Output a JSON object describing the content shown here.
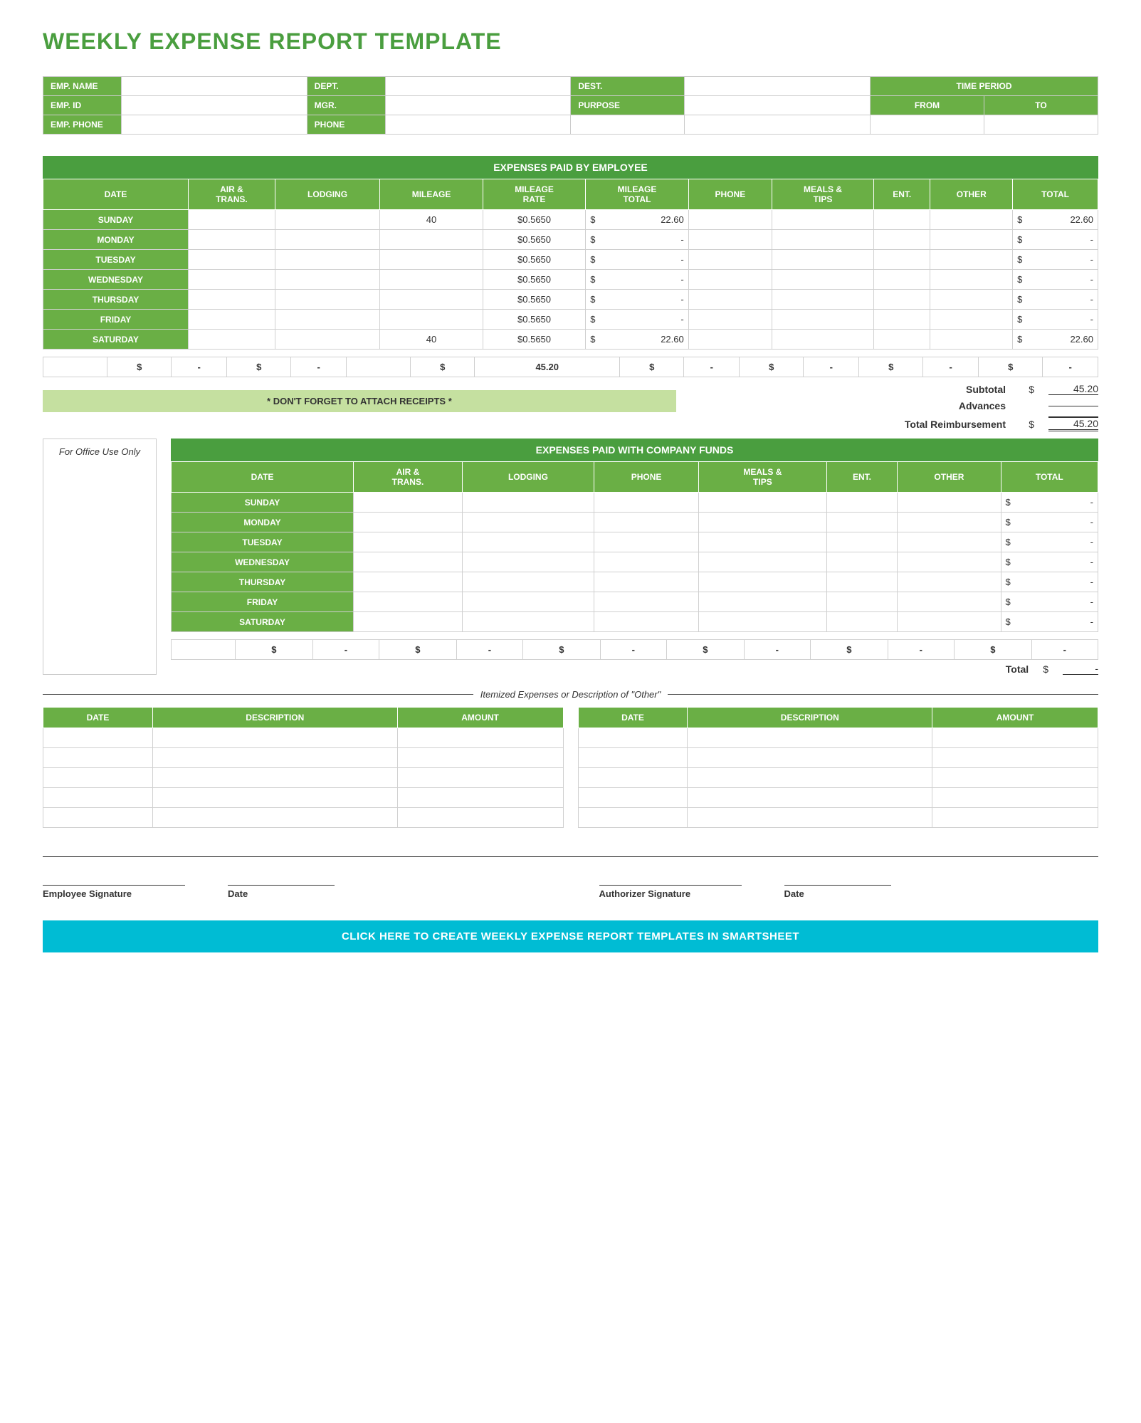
{
  "title": "WEEKLY EXPENSE REPORT TEMPLATE",
  "infoHeader": {
    "empName": {
      "label": "EMP. NAME",
      "value": ""
    },
    "dept": {
      "label": "DEPT.",
      "value": ""
    },
    "dest": {
      "label": "DEST.",
      "value": ""
    },
    "timePeriod": {
      "label": "TIME PERIOD"
    },
    "empId": {
      "label": "EMP. ID",
      "value": ""
    },
    "mgr": {
      "label": "MGR.",
      "value": ""
    },
    "purpose": {
      "label": "PURPOSE",
      "value": ""
    },
    "from": {
      "label": "FROM",
      "value": ""
    },
    "to": {
      "label": "TO",
      "value": ""
    },
    "empPhone": {
      "label": "EMP. PHONE",
      "value": ""
    },
    "phone": {
      "label": "PHONE",
      "value": ""
    }
  },
  "expensesPaidByEmployee": {
    "sectionTitle": "EXPENSES PAID BY EMPLOYEE",
    "columns": [
      "DATE",
      "AIR & TRANS.",
      "LODGING",
      "MILEAGE",
      "MILEAGE RATE",
      "MILEAGE TOTAL",
      "PHONE",
      "MEALS & TIPS",
      "ENT.",
      "OTHER",
      "TOTAL"
    ],
    "rows": [
      {
        "day": "SUNDAY",
        "airTrans": "",
        "lodging": "",
        "mileage": "40",
        "mileageRate": "$0.5650",
        "mileageTotalDollar": "$",
        "mileageTotal": "22.60",
        "phone": "",
        "mealsTips": "",
        "ent": "",
        "other": "",
        "totalDollar": "$",
        "total": "22.60"
      },
      {
        "day": "MONDAY",
        "airTrans": "",
        "lodging": "",
        "mileage": "",
        "mileageRate": "$0.5650",
        "mileageTotalDollar": "$",
        "mileageTotal": "-",
        "phone": "",
        "mealsTips": "",
        "ent": "",
        "other": "",
        "totalDollar": "$",
        "total": "-"
      },
      {
        "day": "TUESDAY",
        "airTrans": "",
        "lodging": "",
        "mileage": "",
        "mileageRate": "$0.5650",
        "mileageTotalDollar": "$",
        "mileageTotal": "-",
        "phone": "",
        "mealsTips": "",
        "ent": "",
        "other": "",
        "totalDollar": "$",
        "total": "-"
      },
      {
        "day": "WEDNESDAY",
        "airTrans": "",
        "lodging": "",
        "mileage": "",
        "mileageRate": "$0.5650",
        "mileageTotalDollar": "$",
        "mileageTotal": "-",
        "phone": "",
        "mealsTips": "",
        "ent": "",
        "other": "",
        "totalDollar": "$",
        "total": "-"
      },
      {
        "day": "THURSDAY",
        "airTrans": "",
        "lodging": "",
        "mileage": "",
        "mileageRate": "$0.5650",
        "mileageTotalDollar": "$",
        "mileageTotal": "-",
        "phone": "",
        "mealsTips": "",
        "ent": "",
        "other": "",
        "totalDollar": "$",
        "total": "-"
      },
      {
        "day": "FRIDAY",
        "airTrans": "",
        "lodging": "",
        "mileage": "",
        "mileageRate": "$0.5650",
        "mileageTotalDollar": "$",
        "mileageTotal": "-",
        "phone": "",
        "mealsTips": "",
        "ent": "",
        "other": "",
        "totalDollar": "$",
        "total": "-"
      },
      {
        "day": "SATURDAY",
        "airTrans": "",
        "lodging": "",
        "mileage": "40",
        "mileageRate": "$0.5650",
        "mileageTotalDollar": "$",
        "mileageTotal": "22.60",
        "phone": "",
        "mealsTips": "",
        "ent": "",
        "other": "",
        "totalDollar": "$",
        "total": "22.60"
      }
    ],
    "totalsRow": {
      "airTransDollar": "$",
      "airTrans": "-",
      "lodgingDollar": "$",
      "lodging": "-",
      "mileageTotalDollar": "$",
      "mileageTotal": "45.20",
      "phoneDollar": "$",
      "phone": "-",
      "mealsTipsDollar": "$",
      "mealsTips": "-",
      "entDollar": "$",
      "ent": "-",
      "otherDollar": "$",
      "other": "-"
    },
    "subtotal": {
      "label": "Subtotal",
      "dollar": "$",
      "amount": "45.20"
    },
    "advances": {
      "label": "Advances",
      "dollar": "",
      "amount": ""
    },
    "totalReimbursement": {
      "label": "Total Reimbursement",
      "dollar": "$",
      "amount": "45.20"
    },
    "receiptBanner": "* DON'T FORGET TO ATTACH RECEIPTS *"
  },
  "forOfficeUseOnly": "For Office Use Only",
  "expensesPaidWithCompanyFunds": {
    "sectionTitle": "EXPENSES PAID WITH COMPANY FUNDS",
    "columns": [
      "DATE",
      "AIR & TRANS.",
      "LODGING",
      "PHONE",
      "MEALS & TIPS",
      "ENT.",
      "OTHER",
      "TOTAL"
    ],
    "rows": [
      {
        "day": "SUNDAY",
        "airTrans": "",
        "lodging": "",
        "phone": "",
        "mealsTips": "",
        "ent": "",
        "other": "",
        "totalDollar": "$",
        "total": "-"
      },
      {
        "day": "MONDAY",
        "airTrans": "",
        "lodging": "",
        "phone": "",
        "mealsTips": "",
        "ent": "",
        "other": "",
        "totalDollar": "$",
        "total": "-"
      },
      {
        "day": "TUESDAY",
        "airTrans": "",
        "lodging": "",
        "phone": "",
        "mealsTips": "",
        "ent": "",
        "other": "",
        "totalDollar": "$",
        "total": "-"
      },
      {
        "day": "WEDNESDAY",
        "airTrans": "",
        "lodging": "",
        "phone": "",
        "mealsTips": "",
        "ent": "",
        "other": "",
        "totalDollar": "$",
        "total": "-"
      },
      {
        "day": "THURSDAY",
        "airTrans": "",
        "lodging": "",
        "phone": "",
        "mealsTips": "",
        "ent": "",
        "other": "",
        "totalDollar": "$",
        "total": "-"
      },
      {
        "day": "FRIDAY",
        "airTrans": "",
        "lodging": "",
        "phone": "",
        "mealsTips": "",
        "ent": "",
        "other": "",
        "totalDollar": "$",
        "total": "-"
      },
      {
        "day": "SATURDAY",
        "airTrans": "",
        "lodging": "",
        "phone": "",
        "mealsTips": "",
        "ent": "",
        "other": "",
        "totalDollar": "$",
        "total": "-"
      }
    ],
    "totalsRow": {
      "airTransDollar": "$",
      "airTrans": "-",
      "lodgingDollar": "$",
      "lodging": "-",
      "phoneDollar": "$",
      "phone": "-",
      "mealsTipsDollar": "$",
      "mealsTips": "-",
      "entDollar": "$",
      "ent": "-",
      "otherDollar": "$",
      "other": "-"
    },
    "total": {
      "label": "Total",
      "dollar": "$",
      "amount": "-"
    }
  },
  "itemized": {
    "headerTitle": "Itemized Expenses or Description of \"Other\"",
    "leftTable": {
      "columns": [
        "DATE",
        "DESCRIPTION",
        "AMOUNT"
      ],
      "rows": [
        "",
        "",
        "",
        "",
        ""
      ]
    },
    "rightTable": {
      "columns": [
        "DATE",
        "DESCRIPTION",
        "AMOUNT"
      ],
      "rows": [
        "",
        "",
        "",
        "",
        ""
      ]
    }
  },
  "signatures": {
    "employeeSignature": {
      "label": "Employee Signature"
    },
    "date1": {
      "label": "Date"
    },
    "authorizerSignature": {
      "label": "Authorizer Signature"
    },
    "date2": {
      "label": "Date"
    }
  },
  "footer": {
    "bannerText": "CLICK HERE TO CREATE WEEKLY EXPENSE REPORT TEMPLATES IN SMARTSHEET"
  }
}
